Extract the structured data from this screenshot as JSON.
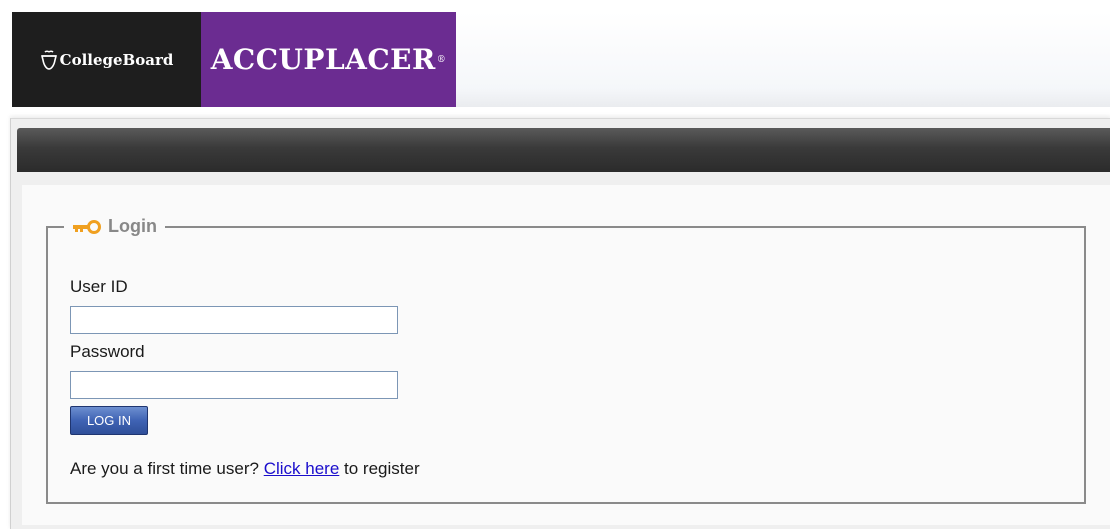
{
  "header": {
    "collegeboard_text": "CollegeBoard",
    "product_name": "ACCUPLACER",
    "product_mark": "®"
  },
  "login": {
    "legend": "Login",
    "user_id_label": "User ID",
    "user_id_value": "",
    "password_label": "Password",
    "password_value": "",
    "submit_label": "LOG IN",
    "register_prefix": "Are you a first time user?",
    "register_link": "Click here",
    "register_suffix": "to register"
  },
  "colors": {
    "brand_purple": "#6b2c91",
    "brand_black": "#1e1e1e",
    "key_icon": "#f0a020",
    "button_blue": "#3f63b4",
    "link_blue": "#1a0dcc"
  },
  "icons": {
    "logo": "acorn-icon",
    "legend": "key-icon"
  }
}
